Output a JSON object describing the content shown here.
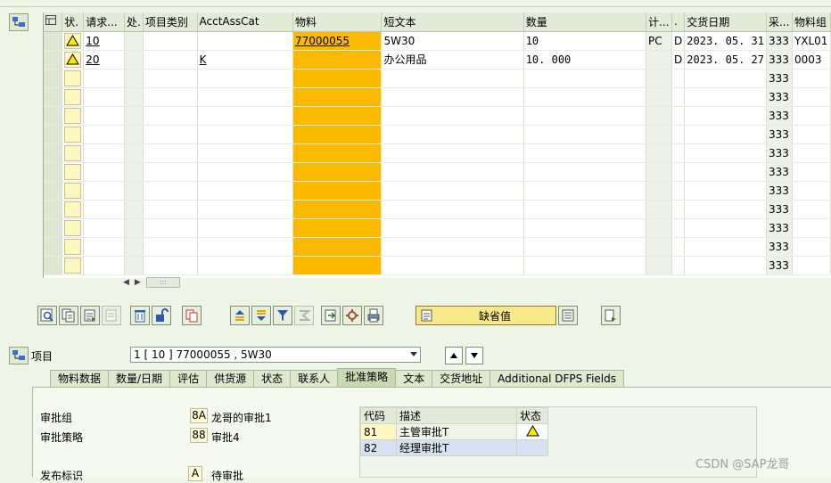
{
  "grid": {
    "columns": {
      "sel": "",
      "status": "状.",
      "req_item": "请求...",
      "proc": "处.",
      "item_cat": "项目类别",
      "acct_ass_cat": "AcctAssCat",
      "material": "物料",
      "short_text": "短文本",
      "quantity": "数量",
      "unit": "计...",
      "d": ".",
      "delivery_date": "交货日期",
      "purch": "采...",
      "mat_group": "物料组"
    },
    "rows": [
      {
        "item": "10",
        "item_cat": "",
        "acct": "",
        "material": "77000055",
        "text": "5W30",
        "qty": "10",
        "unit": "PC",
        "d": "D",
        "date": "2023. 05. 31",
        "purch": "333",
        "group": "YXL01"
      },
      {
        "item": "20",
        "item_cat": "",
        "acct": "K",
        "material": "",
        "text": "办公用品",
        "qty": "10. 000",
        "unit": "",
        "d": "D",
        "date": "2023. 05. 27",
        "purch": "333",
        "group": "0003"
      },
      {
        "item": "",
        "item_cat": "",
        "acct": "",
        "material": "",
        "text": "",
        "qty": "",
        "unit": "",
        "d": "",
        "date": "",
        "purch": "333",
        "group": ""
      },
      {
        "item": "",
        "item_cat": "",
        "acct": "",
        "material": "",
        "text": "",
        "qty": "",
        "unit": "",
        "d": "",
        "date": "",
        "purch": "333",
        "group": ""
      },
      {
        "item": "",
        "item_cat": "",
        "acct": "",
        "material": "",
        "text": "",
        "qty": "",
        "unit": "",
        "d": "",
        "date": "",
        "purch": "333",
        "group": ""
      },
      {
        "item": "",
        "item_cat": "",
        "acct": "",
        "material": "",
        "text": "",
        "qty": "",
        "unit": "",
        "d": "",
        "date": "",
        "purch": "333",
        "group": ""
      },
      {
        "item": "",
        "item_cat": "",
        "acct": "",
        "material": "",
        "text": "",
        "qty": "",
        "unit": "",
        "d": "",
        "date": "",
        "purch": "333",
        "group": ""
      },
      {
        "item": "",
        "item_cat": "",
        "acct": "",
        "material": "",
        "text": "",
        "qty": "",
        "unit": "",
        "d": "",
        "date": "",
        "purch": "333",
        "group": ""
      },
      {
        "item": "",
        "item_cat": "",
        "acct": "",
        "material": "",
        "text": "",
        "qty": "",
        "unit": "",
        "d": "",
        "date": "",
        "purch": "333",
        "group": ""
      },
      {
        "item": "",
        "item_cat": "",
        "acct": "",
        "material": "",
        "text": "",
        "qty": "",
        "unit": "",
        "d": "",
        "date": "",
        "purch": "333",
        "group": ""
      },
      {
        "item": "",
        "item_cat": "",
        "acct": "",
        "material": "",
        "text": "",
        "qty": "",
        "unit": "",
        "d": "",
        "date": "",
        "purch": "333",
        "group": ""
      },
      {
        "item": "",
        "item_cat": "",
        "acct": "",
        "material": "",
        "text": "",
        "qty": "",
        "unit": "",
        "d": "",
        "date": "",
        "purch": "333",
        "group": ""
      },
      {
        "item": "",
        "item_cat": "",
        "acct": "",
        "material": "",
        "text": "",
        "qty": "",
        "unit": "",
        "d": "",
        "date": "",
        "purch": "333",
        "group": ""
      }
    ],
    "scroll_thumb": ":::"
  },
  "toolbar": {
    "default_values_label": "缺省值"
  },
  "item_selector": {
    "label": "项目",
    "value": "1 [ 10 ] 77000055 , 5W30"
  },
  "tabs": [
    {
      "label": "物料数据",
      "active": false
    },
    {
      "label": "数量/日期",
      "active": false
    },
    {
      "label": "评估",
      "active": false
    },
    {
      "label": "供货源",
      "active": false
    },
    {
      "label": "状态",
      "active": false
    },
    {
      "label": "联系人",
      "active": false
    },
    {
      "label": "批准策略",
      "active": true
    },
    {
      "label": "文本",
      "active": false
    },
    {
      "label": "交货地址",
      "active": false
    },
    {
      "label": "Additional DFPS Fields",
      "active": false
    }
  ],
  "release": {
    "group_label": "审批组",
    "group_code": "8A",
    "group_desc": "龙哥的审批1",
    "strategy_label": "审批策略",
    "strategy_code": "88",
    "strategy_desc": "审批4",
    "indicator_label": "发布标识",
    "indicator_code": "A",
    "indicator_desc": "待审批"
  },
  "approval_table": {
    "headers": {
      "code": "代码",
      "desc": "描述",
      "status": "状态"
    },
    "rows": [
      {
        "code": "81",
        "desc": "主管审批T",
        "status": "warning"
      },
      {
        "code": "82",
        "desc": "经理审批T",
        "status": ""
      }
    ]
  },
  "watermark": "CSDN @SAP龙哥",
  "colors": {
    "material_column": "#fbb900",
    "status_cell": "#fef7c0",
    "warning": "#ffe900"
  }
}
